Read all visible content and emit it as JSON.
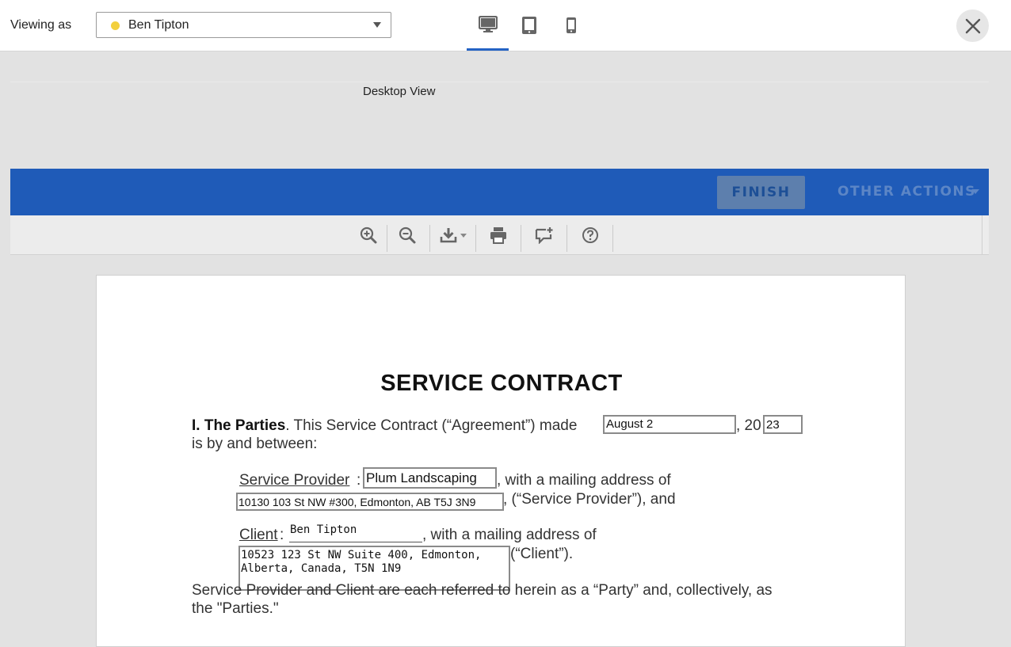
{
  "topbar": {
    "viewing_as_label": "Viewing as",
    "viewer_name": "Ben Tipton",
    "viewer_dot_color": "#f3d03e",
    "devices": [
      {
        "name": "desktop-icon",
        "active": true
      },
      {
        "name": "tablet-icon",
        "active": false
      },
      {
        "name": "mobile-icon",
        "active": false
      }
    ],
    "close_icon": "close-icon"
  },
  "preview": {
    "label": "Desktop View"
  },
  "actionbar": {
    "finish_label": "FINISH",
    "other_actions_label": "OTHER ACTIONS",
    "color": "#1f5bb8"
  },
  "toolbar": {
    "tools": [
      "zoom-in-icon",
      "zoom-out-icon",
      "download-icon",
      "print-icon",
      "comment-add-icon",
      "help-icon"
    ]
  },
  "document": {
    "title": "SERVICE CONTRACT",
    "parties_heading": "I. The Parties",
    "parties_intro": ". This Service Contract (“Agreement”) made",
    "date_value": "August 2",
    "year_prefix": ", 20",
    "year_value": "23",
    "between_text": "is by and between:",
    "provider_label": "Service Provider",
    "provider_colon": ":",
    "provider_value": "Plum Landscaping",
    "provider_mailing": ", with a mailing address of",
    "provider_address": "10130 103 St NW #300, Edmonton, AB T5J 3N9",
    "provider_suffix": ", (“Service Provider”), and",
    "client_label": "Client",
    "client_colon": ":",
    "client_value": "Ben Tipton",
    "client_mailing": ", with a mailing address of",
    "client_address_line1": "10523 123 St NW Suite 400, Edmonton,",
    "client_address_line2": "Alberta, Canada, T5N 1N9",
    "client_suffix": "(“Client”).",
    "collective_line1": "Service Provider and Client are each referred to herein as a “Party” and, collectively, as",
    "collective_line2": "the \"Parties.\""
  }
}
